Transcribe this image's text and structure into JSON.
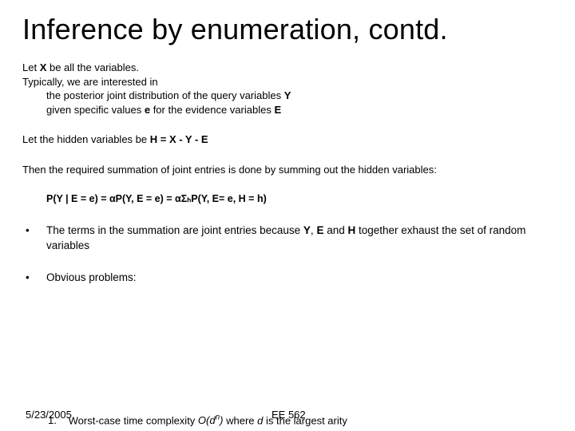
{
  "title": "Inference by enumeration, contd.",
  "intro": {
    "l1a": "Let ",
    "X": "X",
    "l1b": " be all the variables.",
    "l2": "Typically, we are interested in",
    "l3a": "the posterior joint distribution of the query variables ",
    "Y": "Y",
    "l4a": "given specific values ",
    "e": "e",
    "l4b": " for the evidence variables ",
    "E": "E"
  },
  "hidden": {
    "a": "Let the hidden variables be ",
    "eq": "H = X - Y - E"
  },
  "sum": "Then the required summation of joint entries is done by summing out the hidden variables:",
  "equation": "P(Y | E = e) = αP(Y, E = e) = αΣₕP(Y, E= e, H = h)",
  "bullets": {
    "b1a": "The terms in the summation are joint entries because ",
    "b1Y": "Y",
    "b1comma": ", ",
    "b1E": "E",
    "b1and": " and ",
    "b1H": "H",
    "b1b": " together exhaust the set of random variables",
    "b2": "Obvious problems:"
  },
  "footer": {
    "date": "5/23/2005",
    "course": "EE 562"
  },
  "sub": {
    "num": "1.",
    "a": "Worst-case time complexity ",
    "O": "O(d",
    "exp": "n",
    "close": ")",
    "b": " where ",
    "d": "d",
    "c": " is the largest arity"
  }
}
